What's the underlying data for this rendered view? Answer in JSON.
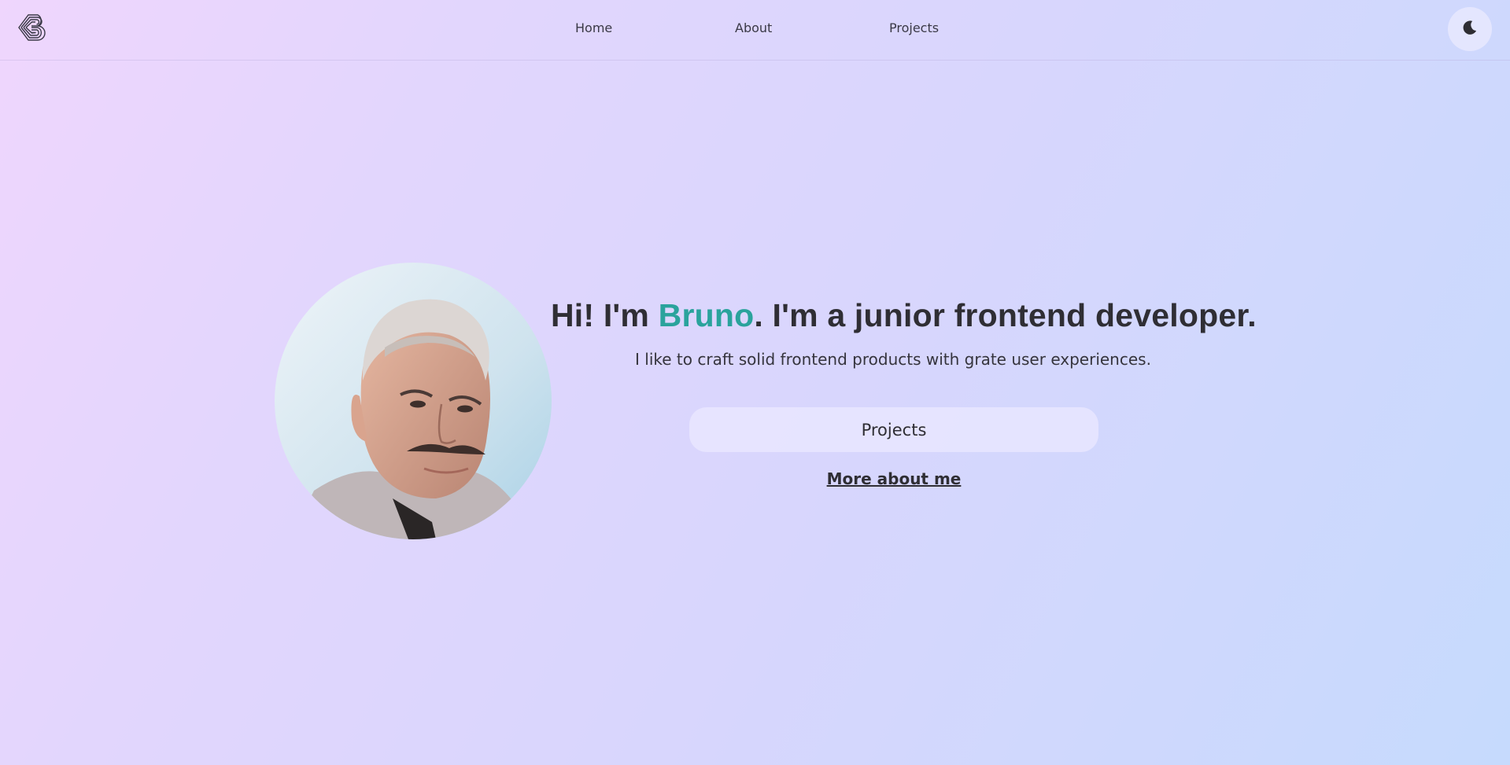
{
  "nav": {
    "logo_icon": "b-monogram-logo-icon",
    "links": [
      {
        "label": "Home"
      },
      {
        "label": "About"
      },
      {
        "label": "Projects"
      }
    ],
    "theme_toggle_icon": "moon-icon"
  },
  "hero": {
    "title_prefix": "Hi! I'm ",
    "title_name": "Bruno",
    "title_suffix": ". I'm a junior frontend developer.",
    "subtitle": "I like to craft solid frontend products with grate user experiences.",
    "primary_button": "Projects",
    "secondary_link": "More about me",
    "accent_color": "#2aa39c"
  }
}
